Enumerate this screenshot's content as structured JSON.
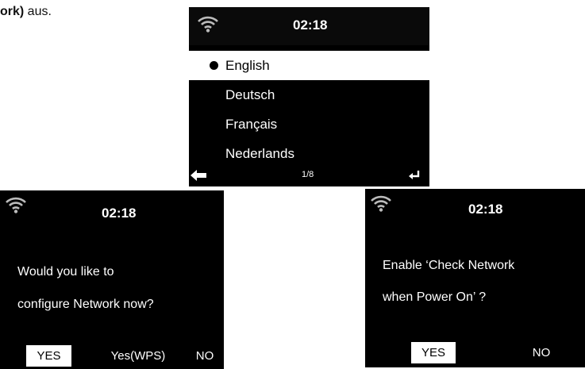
{
  "caption": {
    "bold": "ork)",
    "rest": " aus."
  },
  "screens": {
    "language": {
      "time": "02:18",
      "languages": [
        "English",
        "Deutsch",
        "Français",
        "Nederlands"
      ],
      "selected_index": 0,
      "page_indicator": "1/8"
    },
    "network": {
      "time": "02:18",
      "line1": "Would you like to",
      "line2": "configure Network now?",
      "options": [
        "YES",
        "Yes(WPS)",
        "NO"
      ],
      "selected_option": "YES"
    },
    "check": {
      "time": "02:18",
      "line1": "Enable ‘Check Network",
      "line2": "when Power On’ ?",
      "options": [
        "YES",
        "NO"
      ],
      "selected_option": "YES"
    }
  }
}
